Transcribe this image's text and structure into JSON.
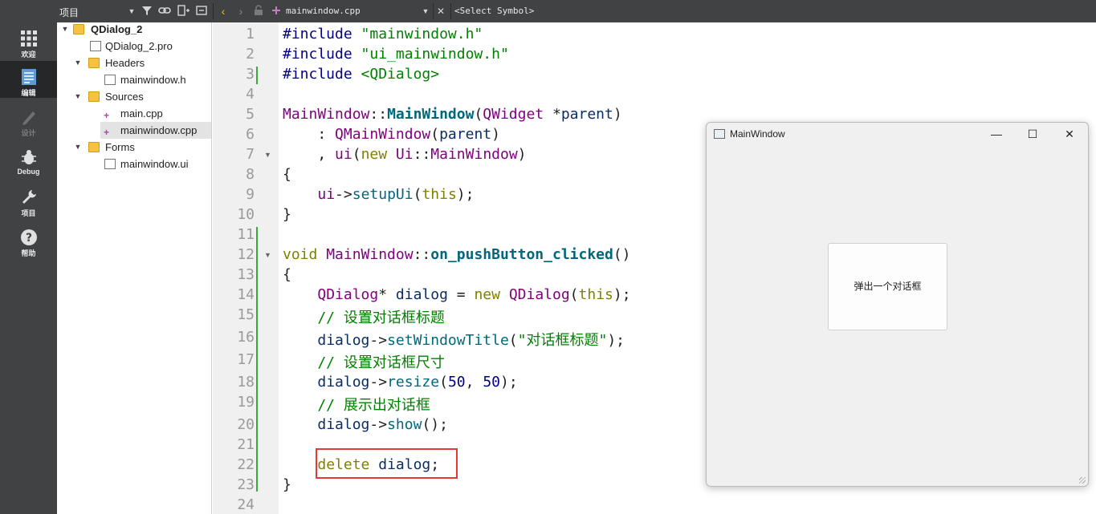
{
  "toolbar": {
    "project_title": "项目",
    "file_tab": "mainwindow.cpp",
    "symbol_select": "<Select Symbol>"
  },
  "modes": [
    {
      "label": "欢迎"
    },
    {
      "label": "编辑"
    },
    {
      "label": "设计"
    },
    {
      "label": "Debug"
    },
    {
      "label": "项目"
    },
    {
      "label": "帮助"
    }
  ],
  "tree": {
    "project": "QDialog_2",
    "pro_file": "QDialog_2.pro",
    "headers": "Headers",
    "header_file": "mainwindow.h",
    "sources": "Sources",
    "source_1": "main.cpp",
    "source_2": "mainwindow.cpp",
    "forms": "Forms",
    "form_file": "mainwindow.ui"
  },
  "editor": {
    "line_numbers": [
      "1",
      "2",
      "3",
      "4",
      "5",
      "6",
      "7",
      "8",
      "9",
      "10",
      "11",
      "12",
      "13",
      "14",
      "15",
      "16",
      "17",
      "18",
      "19",
      "20",
      "21",
      "22",
      "23",
      "24"
    ],
    "l1_pp": "#include",
    "l1_str": "\"mainwindow.h\"",
    "l2_pp": "#include",
    "l2_str": "\"ui_mainwindow.h\"",
    "l3_pp": "#include",
    "l3_str": "<QDialog>",
    "l5_a": "MainWindow",
    "l5_b": "::",
    "l5_c": "MainWindow",
    "l5_d": "(",
    "l5_e": "QWidget",
    "l5_f": " *",
    "l5_g": "parent",
    "l5_h": ")",
    "l6_a": "    : ",
    "l6_b": "QMainWindow",
    "l6_c": "(",
    "l6_d": "parent",
    "l6_e": ")",
    "l7_a": "    , ",
    "l7_b": "ui",
    "l7_c": "(",
    "l7_d": "new",
    "l7_e": " ",
    "l7_f": "Ui",
    "l7_g": "::",
    "l7_h": "MainWindow",
    "l7_i": ")",
    "l8": "{",
    "l9_a": "    ",
    "l9_b": "ui",
    "l9_c": "->",
    "l9_d": "setupUi",
    "l9_e": "(",
    "l9_f": "this",
    "l9_g": ");",
    "l10": "}",
    "l12_a": "void",
    "l12_b": " ",
    "l12_c": "MainWindow",
    "l12_d": "::",
    "l12_e": "on_pushButton_clicked",
    "l12_f": "()",
    "l13": "{",
    "l14_a": "    ",
    "l14_b": "QDialog",
    "l14_c": "* ",
    "l14_d": "dialog",
    "l14_e": " = ",
    "l14_f": "new",
    "l14_g": " ",
    "l14_h": "QDialog",
    "l14_i": "(",
    "l14_j": "this",
    "l14_k": ");",
    "l15": "    // 设置对话框标题",
    "l16_a": "    ",
    "l16_b": "dialog",
    "l16_c": "->",
    "l16_d": "setWindowTitle",
    "l16_e": "(",
    "l16_f": "\"对话框标题\"",
    "l16_g": ");",
    "l17": "    // 设置对话框尺寸",
    "l18_a": "    ",
    "l18_b": "dialog",
    "l18_c": "->",
    "l18_d": "resize",
    "l18_e": "(",
    "l18_f": "50",
    "l18_g": ", ",
    "l18_h": "50",
    "l18_i": ");",
    "l19": "    // 展示出对话框",
    "l20_a": "    ",
    "l20_b": "dialog",
    "l20_c": "->",
    "l20_d": "show",
    "l20_e": "();",
    "l22_a": "    ",
    "l22_b": "delete",
    "l22_c": " ",
    "l22_d": "dialog",
    "l22_e": ";",
    "l23": "}"
  },
  "app_window": {
    "title": "MainWindow",
    "minimize": "—",
    "maximize": "☐",
    "close": "✕",
    "button_label": "弹出一个对话框"
  }
}
